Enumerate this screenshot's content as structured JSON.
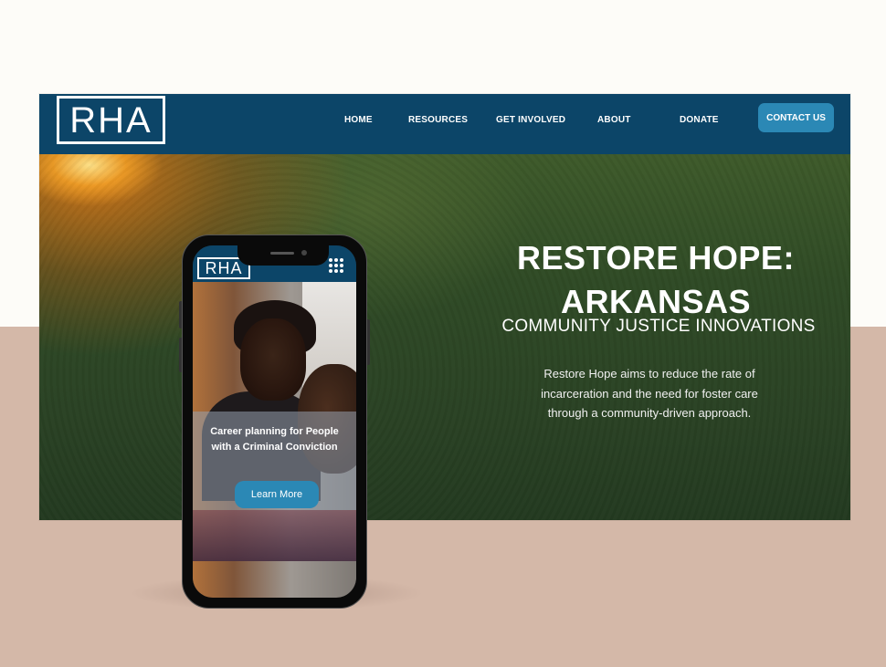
{
  "desktop": {
    "logo_text": "RHA",
    "nav": {
      "items": [
        {
          "label": "HOME"
        },
        {
          "label": "RESOURCES"
        },
        {
          "label": "GET INVOLVED"
        },
        {
          "label": "ABOUT"
        },
        {
          "label": "DONATE"
        }
      ],
      "contact_label": "CONTACT US"
    },
    "hero": {
      "title_line1": "RESTORE HOPE:",
      "title_line2": "ARKANSAS",
      "subtitle": "COMMUNITY JUSTICE INNOVATIONS",
      "description": "Restore Hope aims to reduce the rate of incarceration and the need for foster care through a community-driven approach."
    }
  },
  "mobile": {
    "logo_text": "RHA",
    "menu_icon": "grid-menu-icon",
    "headline": "Career planning for People with a Criminal Conviction",
    "button_label": "Learn More"
  },
  "colors": {
    "nav_bg": "#0c4568",
    "accent": "#2b88b5",
    "bg_top": "#fdfcf8",
    "bg_bottom": "#d4b8a8"
  }
}
